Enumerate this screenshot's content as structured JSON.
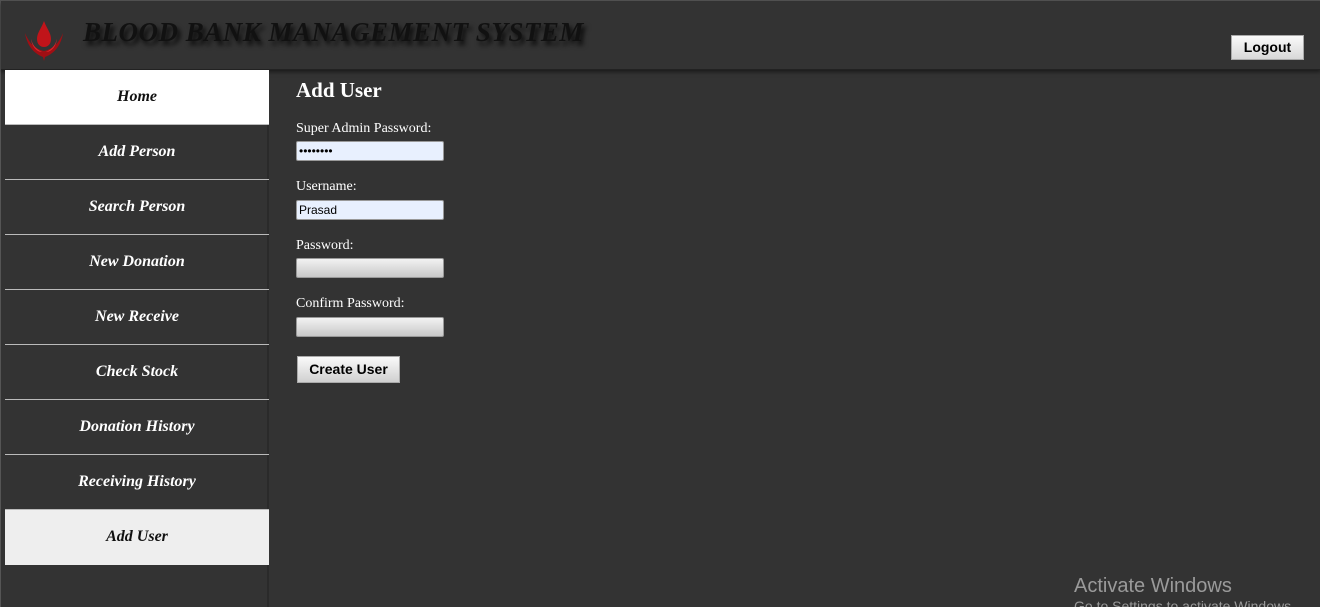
{
  "header": {
    "title": "BLOOD BANK MANAGEMENT SYSTEM",
    "logout_label": "Logout",
    "logo_icon": "blood-drop-logo-icon"
  },
  "sidebar": {
    "items": [
      {
        "label": "Home"
      },
      {
        "label": "Add Person"
      },
      {
        "label": "Search Person"
      },
      {
        "label": "New Donation"
      },
      {
        "label": "New Receive"
      },
      {
        "label": "Check Stock"
      },
      {
        "label": "Donation History"
      },
      {
        "label": "Receiving History"
      },
      {
        "label": "Add User"
      }
    ],
    "active": "Add User"
  },
  "main": {
    "title": "Add User",
    "fields": {
      "super_admin_password": {
        "label": "Super Admin Password:",
        "value": "••••••••"
      },
      "username": {
        "label": "Username:",
        "value": "Prasad"
      },
      "password": {
        "label": "Password:",
        "value": ""
      },
      "confirm_password": {
        "label": "Confirm Password:",
        "value": ""
      }
    },
    "create_button_label": "Create User"
  },
  "watermark": {
    "title": "Activate Windows",
    "subtitle": "Go to Settings to activate Windows."
  },
  "colors": {
    "background": "#333333",
    "logo_red": "#c0141a",
    "input_autofill": "#e8f0fe"
  }
}
